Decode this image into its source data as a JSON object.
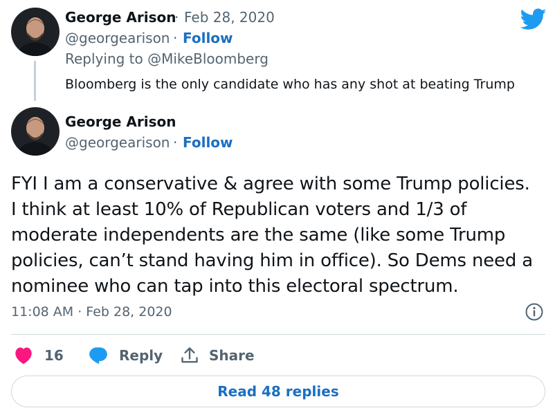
{
  "reply_tweet": {
    "author_name": "George Arison",
    "separator": "·",
    "date": "Feb 28, 2020",
    "handle": "@georgearison",
    "follow_label": "Follow",
    "replying_to": "Replying to @MikeBloomberg",
    "text": "Bloomberg is the only candidate who has any shot at beating Trump"
  },
  "main_tweet": {
    "author_name": "George Arison",
    "handle": "@georgearison",
    "separator": "·",
    "follow_label": "Follow",
    "text_lines": [
      "FYI I am a conservative & agree with some Trump policies.",
      "I think at least 10% of Republican voters and 1/3 of",
      "moderate independents are the same (like some Trump",
      "policies, can’t stand having him in office). So Dems need a",
      "nominee who can tap into this electoral spectrum."
    ],
    "timestamp": "11:08 AM · Feb 28, 2020"
  },
  "actions": {
    "like_count": "16",
    "reply_label": "Reply",
    "share_label": "Share"
  },
  "read_replies_label": "Read 48 replies",
  "icons": {
    "logo": "twitter-bird-icon",
    "info": "info-icon",
    "like": "heart-icon",
    "reply": "speech-bubble-icon",
    "share": "share-upload-icon"
  },
  "colors": {
    "brand_blue": "#1d9bf0",
    "link_blue": "#1b6fc1",
    "like_pink": "#f91880",
    "text_primary": "#0f1419",
    "text_secondary": "#536471"
  }
}
